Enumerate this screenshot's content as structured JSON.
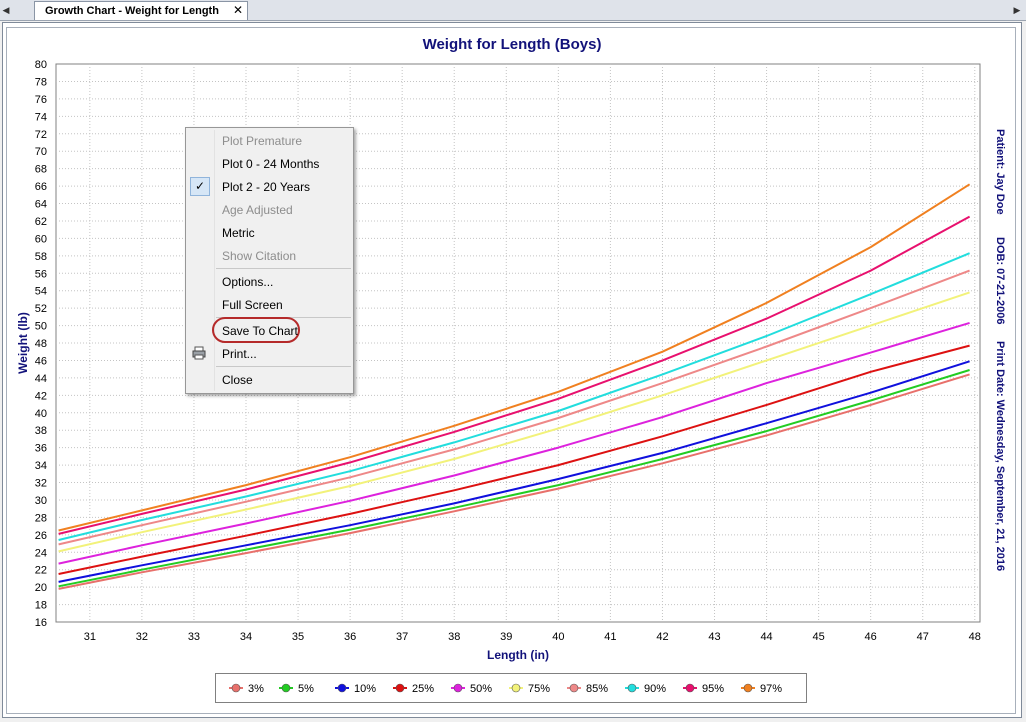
{
  "tab": {
    "title": "Growth Chart - Weight for Length",
    "close": "✕",
    "scroll_left": "◀",
    "scroll_right": "▶"
  },
  "menu": {
    "items": [
      {
        "label": "Plot Premature",
        "disabled": true
      },
      {
        "label": "Plot 0 - 24 Months",
        "disabled": false
      },
      {
        "label": "Plot 2 - 20 Years",
        "disabled": false,
        "checked": true
      },
      {
        "label": "Age Adjusted",
        "disabled": true
      },
      {
        "label": "Metric",
        "disabled": false
      },
      {
        "label": "Show Citation",
        "disabled": true
      },
      {
        "label": "Options...",
        "disabled": false
      },
      {
        "label": "Full Screen",
        "disabled": false
      },
      {
        "label": "Save To Chart",
        "disabled": false,
        "highlighted": true
      },
      {
        "label": "Print...",
        "disabled": false,
        "icon": "printer-icon"
      },
      {
        "label": "Close",
        "disabled": false
      }
    ]
  },
  "side_info": {
    "patient": "Patient: Jay Doe",
    "dob": "DOB: 07-21-2006",
    "print_date": "Print Date: Wednesday, September, 21, 2016"
  },
  "chart_data": {
    "type": "line",
    "title": "Weight for Length (Boys)",
    "xlabel": "Length (in)",
    "ylabel": "Weight (lb)",
    "xlim": [
      30.35,
      48.1
    ],
    "ylim": [
      16,
      80
    ],
    "xticks": [
      31,
      32,
      33,
      34,
      35,
      36,
      37,
      38,
      39,
      40,
      41,
      42,
      43,
      44,
      45,
      46,
      47,
      48
    ],
    "yticks": [
      16,
      18,
      20,
      22,
      24,
      26,
      28,
      30,
      32,
      34,
      36,
      38,
      40,
      42,
      44,
      46,
      48,
      50,
      52,
      54,
      56,
      58,
      60,
      62,
      64,
      66,
      68,
      70,
      72,
      74,
      76,
      78,
      80
    ],
    "grid": true,
    "legend_position": "bottom",
    "x": [
      30.4,
      32,
      34,
      36,
      38,
      40,
      42,
      44,
      46,
      47.9
    ],
    "series": [
      {
        "name": "3%",
        "color": "#e8706b",
        "values": [
          19.8,
          21.7,
          23.9,
          26.2,
          28.7,
          31.3,
          34.2,
          37.4,
          40.9,
          44.4
        ]
      },
      {
        "name": "5%",
        "color": "#22cc22",
        "values": [
          20.1,
          22.0,
          24.3,
          26.6,
          29.1,
          31.7,
          34.7,
          37.9,
          41.4,
          44.9
        ]
      },
      {
        "name": "10%",
        "color": "#1010dd",
        "values": [
          20.6,
          22.5,
          24.8,
          27.1,
          29.6,
          32.4,
          35.4,
          38.8,
          42.3,
          45.9
        ]
      },
      {
        "name": "25%",
        "color": "#dd1111",
        "values": [
          21.5,
          23.5,
          25.9,
          28.4,
          31.1,
          34.0,
          37.3,
          40.9,
          44.7,
          47.7
        ]
      },
      {
        "name": "50%",
        "color": "#dd22dd",
        "values": [
          22.7,
          24.8,
          27.3,
          29.9,
          32.8,
          36.0,
          39.5,
          43.4,
          46.9,
          50.3
        ]
      },
      {
        "name": "75%",
        "color": "#f2f27a",
        "values": [
          24.1,
          26.3,
          28.9,
          31.6,
          34.7,
          38.2,
          42.0,
          46.0,
          50.0,
          53.8
        ]
      },
      {
        "name": "85%",
        "color": "#ee8888",
        "values": [
          24.9,
          27.1,
          29.8,
          32.6,
          35.8,
          39.4,
          43.4,
          47.6,
          52.0,
          56.3
        ]
      },
      {
        "name": "90%",
        "color": "#22dddd",
        "values": [
          25.4,
          27.7,
          30.4,
          33.3,
          36.6,
          40.2,
          44.4,
          48.8,
          53.6,
          58.3
        ]
      },
      {
        "name": "95%",
        "color": "#e8106e",
        "values": [
          26.1,
          28.4,
          31.2,
          34.3,
          37.8,
          41.6,
          46.0,
          50.8,
          56.3,
          62.5
        ]
      },
      {
        "name": "97%",
        "color": "#f08020",
        "values": [
          26.5,
          28.8,
          31.7,
          34.9,
          38.5,
          42.4,
          47.0,
          52.6,
          59.0,
          66.2
        ]
      }
    ]
  }
}
